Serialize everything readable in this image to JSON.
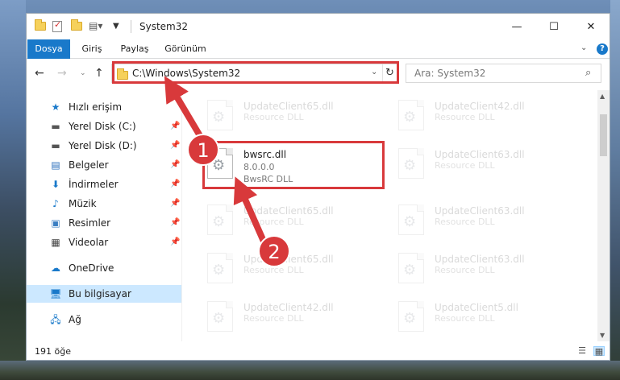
{
  "window": {
    "title": "System32",
    "minimize_glyph": "—",
    "maximize_glyph": "☐",
    "close_glyph": "✕"
  },
  "ribbon": {
    "tabs": [
      "Dosya",
      "Giriş",
      "Paylaş",
      "Görünüm"
    ],
    "help": "?"
  },
  "address": {
    "path": "C:\\Windows\\System32",
    "search_placeholder": "Ara: System32"
  },
  "sidebar": {
    "items": [
      {
        "label": "Hızlı erişim",
        "icon": "star-icon"
      },
      {
        "label": "Yerel Disk (C:)",
        "icon": "drive-icon",
        "pinned": true
      },
      {
        "label": "Yerel Disk (D:)",
        "icon": "drive-icon",
        "pinned": true
      },
      {
        "label": "Belgeler",
        "icon": "documents-icon",
        "pinned": true
      },
      {
        "label": "İndirmeler",
        "icon": "download-icon",
        "pinned": true
      },
      {
        "label": "Müzik",
        "icon": "music-icon",
        "pinned": true
      },
      {
        "label": "Resimler",
        "icon": "pictures-icon",
        "pinned": true
      },
      {
        "label": "Videolar",
        "icon": "videos-icon",
        "pinned": true
      },
      {
        "label": "OneDrive",
        "icon": "cloud-icon"
      },
      {
        "label": "Bu bilgisayar",
        "icon": "computer-icon"
      },
      {
        "label": "Ağ",
        "icon": "network-icon"
      }
    ]
  },
  "files": {
    "left_column": [
      {
        "name": "UpdateClient65.dll",
        "desc": "Resource DLL"
      },
      {
        "name": "bwsrc.dll",
        "version": "8.0.0.0",
        "desc": "BwsRC DLL"
      },
      {
        "name": "UpdateClient65.dll",
        "desc": "Resource DLL"
      },
      {
        "name": "UpdateClient65.dll",
        "desc": "Resource DLL"
      },
      {
        "name": "UpdateClient42.dll",
        "desc": "Resource DLL"
      }
    ],
    "right_column": [
      {
        "name": "UpdateClient42.dll",
        "desc": "Resource DLL"
      },
      {
        "name": "UpdateClient63.dll",
        "desc": "Resource DLL"
      },
      {
        "name": "UpdateClient63.dll",
        "desc": "Resource DLL"
      },
      {
        "name": "UpdateClient63.dll",
        "desc": "Resource DLL"
      },
      {
        "name": "UpdateClient5.dll",
        "desc": "Resource DLL"
      }
    ]
  },
  "status": {
    "count": "191 öğe"
  },
  "annotations": {
    "step1": "1",
    "step2": "2",
    "color": "#d8393b"
  }
}
